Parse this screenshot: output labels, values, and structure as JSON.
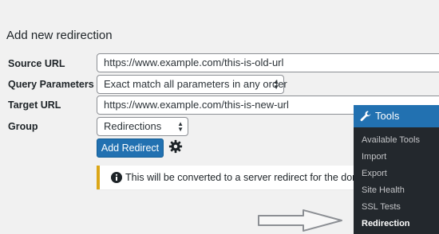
{
  "form": {
    "title": "Add new redirection",
    "source_label": "Source URL",
    "source_value": "https://www.example.com/this-is-old-url",
    "query_label": "Query Parameters",
    "query_value": "Exact match all parameters in any order",
    "target_label": "Target URL",
    "target_value": "https://www.example.com/this-is-new-url",
    "group_label": "Group",
    "group_value": "Redirections",
    "add_button": "Add Redirect",
    "notice": "This will be converted to a server redirect for the domain"
  },
  "menu": {
    "head": "Tools",
    "items": [
      "Available Tools",
      "Import",
      "Export",
      "Site Health",
      "SSL Tests",
      "Redirection"
    ],
    "active": "Redirection"
  },
  "colors": {
    "accent": "#2271b1",
    "notice_border": "#dba617",
    "menu_bg": "#23282d"
  }
}
